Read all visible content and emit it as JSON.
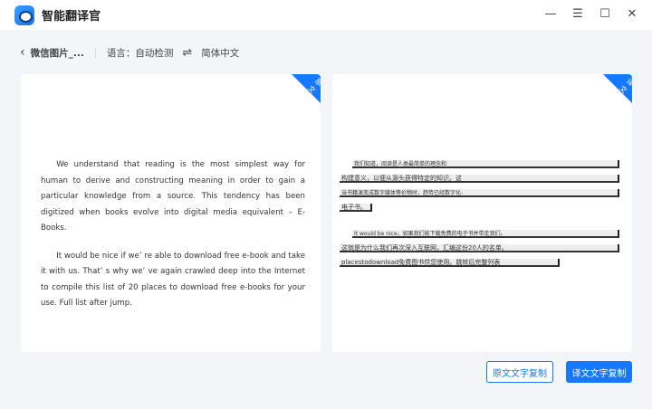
{
  "app": {
    "title": "智能翻译官"
  },
  "window": {
    "minimize": "—",
    "settings": "☰",
    "maximize": "☐",
    "close": "✕"
  },
  "toolbar": {
    "back": "‹",
    "file": "微信图片_...",
    "lang_label": "语言：自动检测",
    "swap": "⇌",
    "target": "简体中文"
  },
  "source": {
    "badge": "原文",
    "paragraphs": [
      "We understand that reading is the most simplest way for human to derive and constructing meaning in order to gain a particular knowledge from a source. This tendency has been digitized when books evolve into digital media equivalent – E-Books.",
      "It would be nice if we’ re able to download free e-book and take it with us. That’ s why we’ ve again crawled deep into the Internet to compile this list of 20 places to download free e-books for your use. Full list after jump."
    ]
  },
  "translation": {
    "badge": "译文",
    "lines": [
      "我们知道，阅读是人类最简单的理念和",
      "构建意义，以便从源头获得特定的知识。这",
      "当书籍演变成数字媒体等价物时，趋势已经数字化-",
      "电子书。",
      "It would be nice，如果我们能下载免费的电子书并带走我们。",
      "这就是为什么我们再次深入互联网，汇编这份20人的名单。",
      "placestodownload免费图书供您使用。跳转后完整列表"
    ]
  },
  "buttons": {
    "copy_source": "原文文字复制",
    "copy_translation": "译文文字复制"
  }
}
